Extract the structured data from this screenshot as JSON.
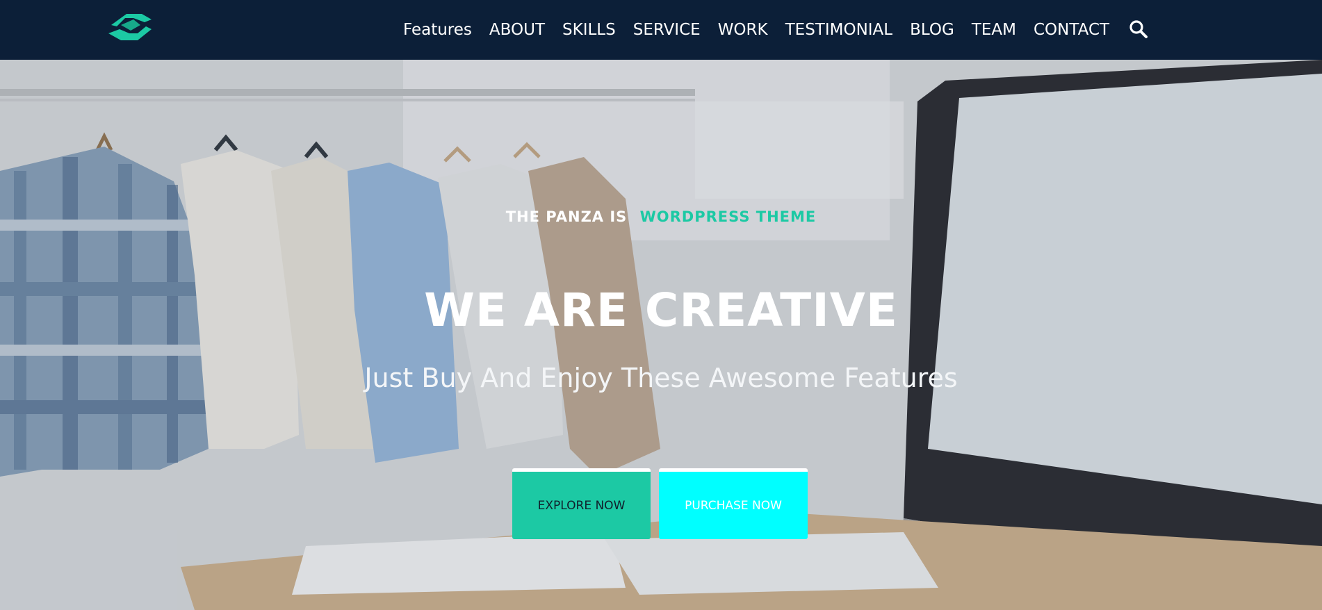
{
  "colors": {
    "nav_bg": "#0c1f38",
    "accent": "#1cc9a4",
    "cyan": "#00ffff",
    "white": "#ffffff"
  },
  "navbar": {
    "logo_icon": "panza-logo-icon",
    "items": [
      {
        "label": "Features"
      },
      {
        "label": "ABOUT"
      },
      {
        "label": "SKILLS"
      },
      {
        "label": "SERVICE"
      },
      {
        "label": "WORK"
      },
      {
        "label": "TESTIMONIAL"
      },
      {
        "label": "BLOG"
      },
      {
        "label": "TEAM"
      },
      {
        "label": "CONTACT"
      }
    ],
    "search_icon": "search-icon"
  },
  "hero": {
    "tagline_prefix": "THE PANZA IS",
    "tagline_highlight": "WORDPRESS THEME",
    "title": "WE ARE CREATIVE",
    "subtitle": "Just Buy And Enjoy These Awesome Features",
    "buttons": {
      "explore": "EXPLORE NOW",
      "purchase": "PURCHASE NOW"
    }
  }
}
